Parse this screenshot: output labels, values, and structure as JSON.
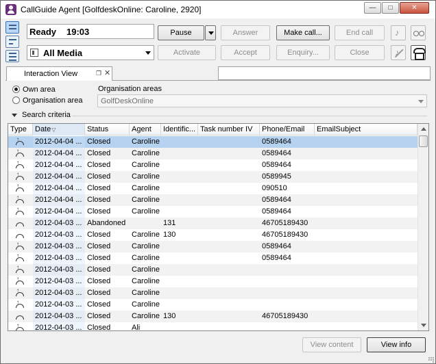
{
  "window": {
    "title": "CallGuide Agent [GolfdeskOnline: Caroline, 2920]",
    "min_glyph": "—",
    "max_glyph": "□",
    "close_glyph": "✕"
  },
  "agent_status": {
    "state": "Ready",
    "time": "19:03",
    "media": "All Media"
  },
  "toolbar": {
    "pause": "Pause",
    "answer": "Answer",
    "make_call": "Make call...",
    "end_call": "End call",
    "activate": "Activate",
    "accept": "Accept",
    "enquiry": "Enquiry...",
    "close": "Close"
  },
  "tabs": {
    "interaction_view": "Interaction View",
    "pin_glyph": "❐",
    "close_glyph": "✕"
  },
  "filters": {
    "own_area": "Own area",
    "organisation_area": "Organisation area",
    "own_area_selected": true,
    "org_areas_label": "Organisation areas",
    "org_areas_value": "GolfDeskOnline",
    "search_criteria": "Search criteria"
  },
  "table": {
    "columns": [
      "Type",
      "Date",
      "Status",
      "Agent",
      "Identific...",
      "Task number IV",
      "Phone/Email",
      "EmailSubject"
    ],
    "sorted_column": "Date",
    "sort_glyph": "▽",
    "rows": [
      {
        "type": "phone-out",
        "date": "2012-04-04 ...",
        "status": "Closed",
        "agent": "Caroline",
        "ident": "",
        "task": "",
        "phone": "0589464",
        "subject": ""
      },
      {
        "type": "phone-out",
        "date": "2012-04-04 ...",
        "status": "Closed",
        "agent": "Caroline",
        "ident": "",
        "task": "",
        "phone": "0589464",
        "subject": ""
      },
      {
        "type": "phone-out",
        "date": "2012-04-04 ...",
        "status": "Closed",
        "agent": "Caroline",
        "ident": "",
        "task": "",
        "phone": "0589464",
        "subject": ""
      },
      {
        "type": "phone-out",
        "date": "2012-04-04 ...",
        "status": "Closed",
        "agent": "Caroline",
        "ident": "",
        "task": "",
        "phone": "0589945",
        "subject": ""
      },
      {
        "type": "phone-out",
        "date": "2012-04-04 ...",
        "status": "Closed",
        "agent": "Caroline",
        "ident": "",
        "task": "",
        "phone": "090510",
        "subject": ""
      },
      {
        "type": "phone-out",
        "date": "2012-04-04 ...",
        "status": "Closed",
        "agent": "Caroline",
        "ident": "",
        "task": "",
        "phone": "0589464",
        "subject": ""
      },
      {
        "type": "phone-out",
        "date": "2012-04-04 ...",
        "status": "Closed",
        "agent": "Caroline",
        "ident": "",
        "task": "",
        "phone": "0589464",
        "subject": ""
      },
      {
        "type": "phone-in",
        "date": "2012-04-03 ...",
        "status": "Abandoned",
        "agent": "",
        "ident": "131",
        "task": "",
        "phone": "46705189430",
        "subject": ""
      },
      {
        "type": "phone-in",
        "date": "2012-04-03 ...",
        "status": "Closed",
        "agent": "Caroline",
        "ident": "130",
        "task": "",
        "phone": "46705189430",
        "subject": ""
      },
      {
        "type": "phone-out",
        "date": "2012-04-03 ...",
        "status": "Closed",
        "agent": "Caroline",
        "ident": "",
        "task": "",
        "phone": "0589464",
        "subject": ""
      },
      {
        "type": "phone-out",
        "date": "2012-04-03 ...",
        "status": "Closed",
        "agent": "Caroline",
        "ident": "",
        "task": "",
        "phone": "0589464",
        "subject": ""
      },
      {
        "type": "phone-out",
        "date": "2012-04-03 ...",
        "status": "Closed",
        "agent": "Caroline",
        "ident": "",
        "task": "",
        "phone": "",
        "subject": ""
      },
      {
        "type": "phone-out",
        "date": "2012-04-03 ...",
        "status": "Closed",
        "agent": "Caroline",
        "ident": "",
        "task": "",
        "phone": "",
        "subject": ""
      },
      {
        "type": "phone-out",
        "date": "2012-04-03 ...",
        "status": "Closed",
        "agent": "Caroline",
        "ident": "",
        "task": "",
        "phone": "",
        "subject": ""
      },
      {
        "type": "phone-out",
        "date": "2012-04-03 ...",
        "status": "Closed",
        "agent": "Caroline",
        "ident": "",
        "task": "",
        "phone": "",
        "subject": ""
      },
      {
        "type": "phone-in",
        "date": "2012-04-03 ...",
        "status": "Closed",
        "agent": "Caroline",
        "ident": "130",
        "task": "",
        "phone": "46705189430",
        "subject": ""
      },
      {
        "type": "phone-out",
        "date": "2012-04-03 ...",
        "status": "Closed",
        "agent": "Ali",
        "ident": "",
        "task": "",
        "phone": "",
        "subject": ""
      }
    ]
  },
  "footer": {
    "view_content": "View content",
    "view_info": "View info"
  }
}
